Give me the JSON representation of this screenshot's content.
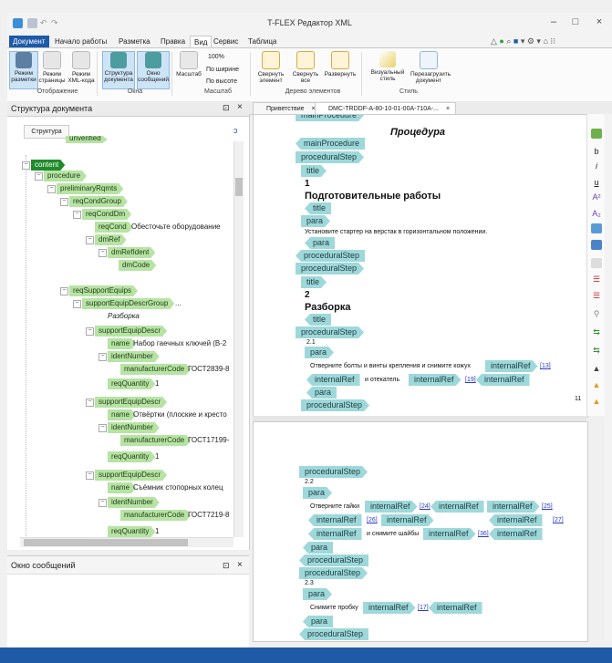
{
  "app": {
    "title": "T-FLEX Редактор XML"
  },
  "menu": {
    "tabs": [
      "Документ",
      "Начало работы",
      "Разметка",
      "Правка",
      "Вид",
      "Сервис",
      "Таблица"
    ],
    "active": "Вид"
  },
  "ribbon": {
    "buttons": {
      "markup_mode": "Режим разметки",
      "page_mode": "Режим страницы",
      "xml_mode": "Режим XML-кода",
      "doc_structure": "Структура документа",
      "msg_window": "Окно сообщений",
      "scale": "Масштаб",
      "zoom_value": "100%",
      "fit_width": "По ширине",
      "fit_height": "По высоте",
      "collapse_elem": "Свернуть элемент",
      "collapse_all": "Свернуть все",
      "expand": "Развернуть",
      "visual_style": "Визуальный стиль",
      "reload_doc": "Перезагрузить документ"
    },
    "groups": {
      "display": "Отображение",
      "windows": "Окна",
      "scale": "Масштаб",
      "tree": "Дерево элементов",
      "style": "Стиль"
    }
  },
  "left_panel": {
    "title": "Структура документа",
    "tab": "Структура",
    "tree": {
      "partial_top": "unverified",
      "content": "content",
      "procedure": "procedure",
      "preliminaryRqmts": "preliminaryRqmts",
      "reqCondGroup": "reqCondGroup",
      "reqCondDm": "reqCondDm",
      "reqCond": "reqCond",
      "reqCond_val": "Обесточьте оборудование",
      "dmRef": "dmRef",
      "dmRefIdent": "dmRefIdent",
      "dmCode": "dmCode",
      "reqSupportEquips": "reqSupportEquips",
      "supportEquipDescrGroup": "supportEquipDescrGroup",
      "supportEquipDescrGroup_val": "...",
      "comment_text": "Разборка",
      "supportEquipDescr": "supportEquipDescr",
      "name": "name",
      "identNumber": "identNumber",
      "manufacturerCode": "manufacturerCode",
      "reqQuantity": "reqQuantity",
      "items": [
        {
          "name": "Набор гаечных ключей (В-2",
          "code": "ГОСТ2839-8",
          "qty": "1"
        },
        {
          "name": "Отвёртки (плоские и кресто",
          "code": "ГОСТ17199-",
          "qty": "1"
        },
        {
          "name": "Съёмник стопорных колец",
          "code": "ГОСТ7219-8",
          "qty": "1"
        }
      ]
    }
  },
  "messages": {
    "title": "Окно сообщений"
  },
  "doc_tabs": [
    "Приветствие",
    "DMC-TRDDF-A-80-10-01-00A-710A-..."
  ],
  "editor": {
    "tags": {
      "mainProcedure": "mainProcedure",
      "proceduralStep": "proceduralStep",
      "title": "title",
      "para": "para",
      "internalRef": "internalRef"
    },
    "heading": "Процедура",
    "step1_num": "1",
    "step1_title": "Подготовительные работы",
    "step1_para": "Установите стартер на верстак в горизонтальном положении.",
    "step2_num": "2",
    "step2_title": "Разборка",
    "step21_num": "2.1",
    "step21_text_a": "Отверните болты и винты крепления и снимите кожух",
    "ref13": "[13]",
    "step21_text_b": "и отекатель",
    "ref19": "[19]",
    "page_number": "11",
    "step22_num": "2.2",
    "step22_text_a": "Отверните гайки",
    "ref24": "[24]",
    "ref25": "[25]",
    "ref26": "[26]",
    "ref27": "[27]",
    "step22_text_b": "и снимите шайбы",
    "ref36": "[36]",
    "step23_num": "2.3",
    "step23_text": "Снимите пробку",
    "ref17": "[17]"
  },
  "colors": {
    "file_tab": "#1e5aa8",
    "tree_tag": "#b7e3a4",
    "tree_tag_selected": "#1f8c2c",
    "xml_tag": "#9fd8da",
    "link": "#2a3ad0",
    "statusbar": "#1f5aa6"
  }
}
